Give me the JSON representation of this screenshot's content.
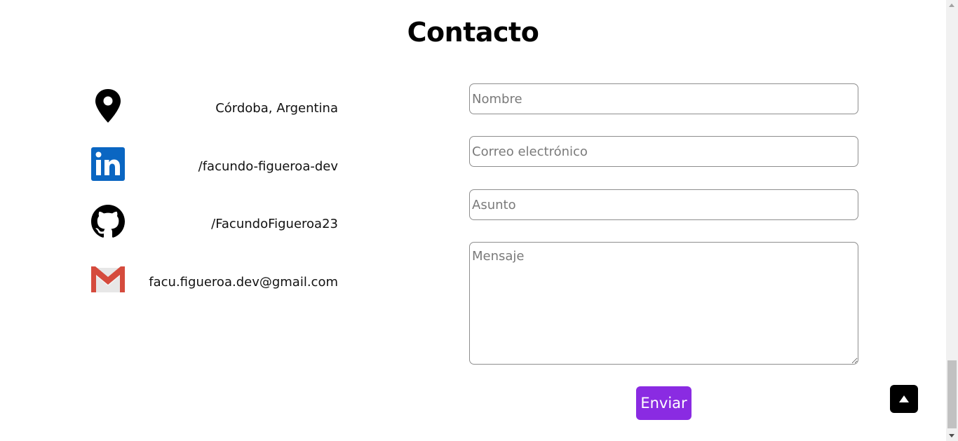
{
  "section": {
    "title": "Contacto"
  },
  "contact_items": [
    {
      "icon": "location-pin-icon",
      "text": "Córdoba, Argentina"
    },
    {
      "icon": "linkedin-icon",
      "text": "/facundo-figueroa-dev"
    },
    {
      "icon": "github-icon",
      "text": "/FacundoFigueroa23"
    },
    {
      "icon": "gmail-icon",
      "text": "facu.figueroa.dev@gmail.com"
    }
  ],
  "form": {
    "name_placeholder": "Nombre",
    "email_placeholder": "Correo electrónico",
    "subject_placeholder": "Asunto",
    "message_placeholder": "Mensaje",
    "submit_label": "Enviar"
  },
  "back_to_top": {
    "icon": "arrow-up-icon"
  },
  "colors": {
    "accent": "#8a2be2",
    "linkedin": "#0a66c2",
    "gmail_red": "#d54b3d"
  }
}
